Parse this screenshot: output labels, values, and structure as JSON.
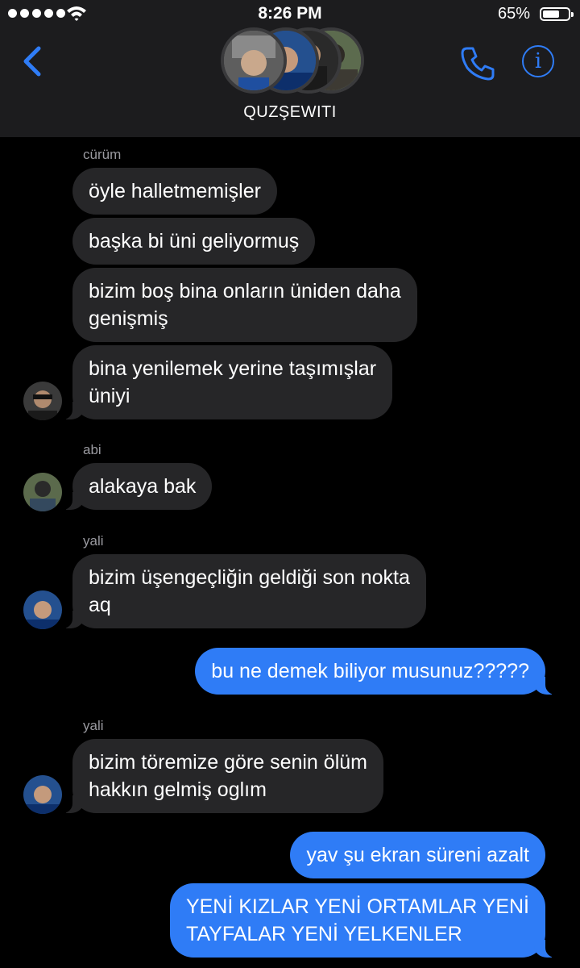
{
  "status_bar": {
    "time": "8:26 PM",
    "battery": "65%",
    "battery_level": 0.65
  },
  "header": {
    "group_name": "QUZŞEWITI",
    "icons": [
      "back-chevron-icon",
      "phone-icon",
      "info-icon"
    ]
  },
  "messages": [
    {
      "sender": "cürüm",
      "direction": "incoming",
      "text": "öyle halletmemişler"
    },
    {
      "direction": "incoming",
      "text": "başka bi üni geliyormuş"
    },
    {
      "direction": "incoming",
      "lines": [
        "bizim boş bina onların üniden daha",
        "genişmiş"
      ]
    },
    {
      "direction": "incoming",
      "lines": [
        "bina yenilemek yerine taşımışlar",
        "üniyi"
      ]
    },
    {
      "sender": "abi",
      "direction": "incoming",
      "text": "alakaya bak"
    },
    {
      "sender": "yali",
      "direction": "incoming",
      "lines": [
        "bizim üşengeçliğin geldiği son nokta",
        "aq"
      ]
    },
    {
      "direction": "outgoing",
      "text": "bu ne demek biliyor musunuz?????"
    },
    {
      "sender": "yali",
      "direction": "incoming",
      "lines": [
        "bizim töremize göre senin ölüm",
        "hakkın gelmiş oglım"
      ]
    },
    {
      "direction": "outgoing",
      "text": "yav şu ekran süreni azalt"
    },
    {
      "direction": "outgoing",
      "lines": [
        "YENİ KIZLAR YENİ ORTAMLAR YENİ",
        "TAYFALAR YENİ YELKENLER"
      ]
    }
  ],
  "colors": {
    "outgoing": "#2f7cf6",
    "incoming": "#262628",
    "accent": "#2f7cf6"
  }
}
